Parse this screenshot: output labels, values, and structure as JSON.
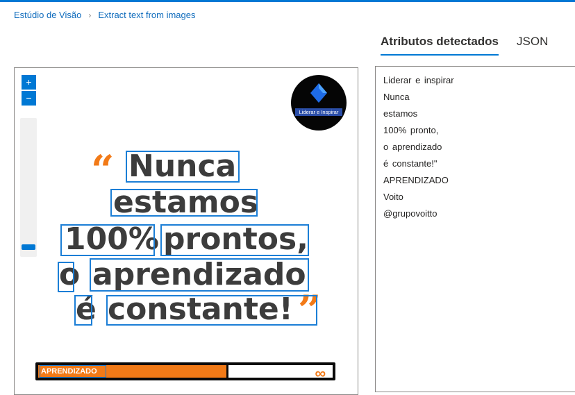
{
  "breadcrumb": {
    "home": "Estúdio de Visão",
    "current": "Extract text from images",
    "separator": "›"
  },
  "tabs": [
    {
      "label": "Atributos detectados",
      "active": true
    },
    {
      "label": "JSON",
      "active": false
    }
  ],
  "viewer": {
    "zoom_in_label": "+",
    "zoom_out_label": "−",
    "logo_caption": "Liderar e Inspirar",
    "quote_open": "“",
    "quote_close": "”",
    "words": [
      {
        "id": "nunca",
        "text": "Nunca"
      },
      {
        "id": "estamos",
        "text": "estamos"
      },
      {
        "id": "100",
        "text": "100%"
      },
      {
        "id": "prontos",
        "text": "prontos,"
      },
      {
        "id": "o",
        "text": "o"
      },
      {
        "id": "aprendizado",
        "text": "aprendizado"
      },
      {
        "id": "e",
        "text": "é"
      },
      {
        "id": "constante",
        "text": "constante!"
      }
    ],
    "banner_label": "APRENDIZADO",
    "banner_symbol": "∞",
    "banner_progress": 0.64
  },
  "detected_text": {
    "lines": [
      "Liderar e inspirar",
      "Nunca",
      "estamos",
      "100% pronto,",
      "o aprendizado",
      "é constante!\"",
      "APRENDIZADO",
      "Voito",
      "@grupovoitto"
    ]
  },
  "colors": {
    "accent": "#0078d4",
    "link": "#0f6cbd",
    "orange": "#f27a17",
    "box": "#1b7ed6",
    "text_dark": "#3c3c3c"
  }
}
